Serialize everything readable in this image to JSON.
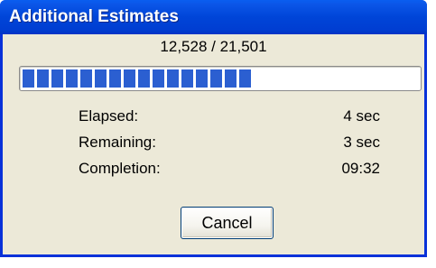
{
  "window": {
    "title": "Additional Estimates"
  },
  "progress": {
    "count_text": "12,528 / 21,501",
    "fraction": 0.58
  },
  "stats": [
    {
      "label": "Elapsed:",
      "value": "4 sec"
    },
    {
      "label": "Remaining:",
      "value": "3 sec"
    },
    {
      "label": "Completion:",
      "value": "09:32"
    }
  ],
  "buttons": {
    "cancel_label": "Cancel"
  },
  "colors": {
    "titlebar": "#0045d8",
    "progress_fill": "#2b5fd1",
    "window_bg": "#ece9d8"
  }
}
